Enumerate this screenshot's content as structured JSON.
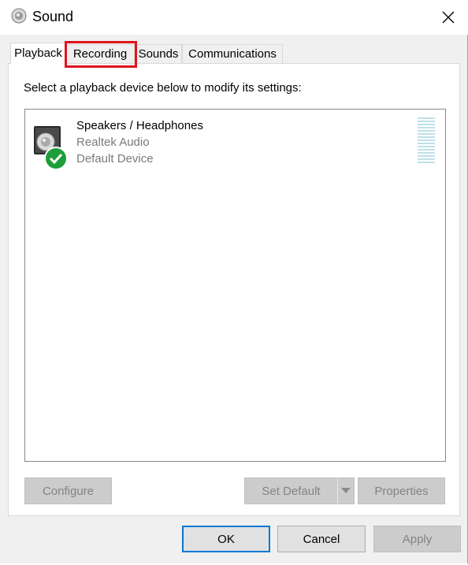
{
  "window": {
    "title": "Sound",
    "icon": "speaker-icon",
    "close_icon": "close-icon"
  },
  "tabs": [
    {
      "label": "Playback",
      "active": true
    },
    {
      "label": "Recording",
      "highlighted": true
    },
    {
      "label": "Sounds"
    },
    {
      "label": "Communications"
    }
  ],
  "playback": {
    "instruction": "Select a playback device below to modify its settings:",
    "devices": [
      {
        "name": "Speakers / Headphones",
        "driver": "Realtek Audio",
        "status": "Default Device",
        "icon": "speaker-device-icon",
        "badge": "green-check-icon"
      }
    ],
    "buttons": {
      "configure": "Configure",
      "set_default": "Set Default",
      "properties": "Properties"
    }
  },
  "dialog_buttons": {
    "ok": "OK",
    "cancel": "Cancel",
    "apply": "Apply"
  },
  "colors": {
    "highlight_box": "#e0141e",
    "default_check": "#1e9e3a",
    "focus_border": "#0078d7"
  }
}
